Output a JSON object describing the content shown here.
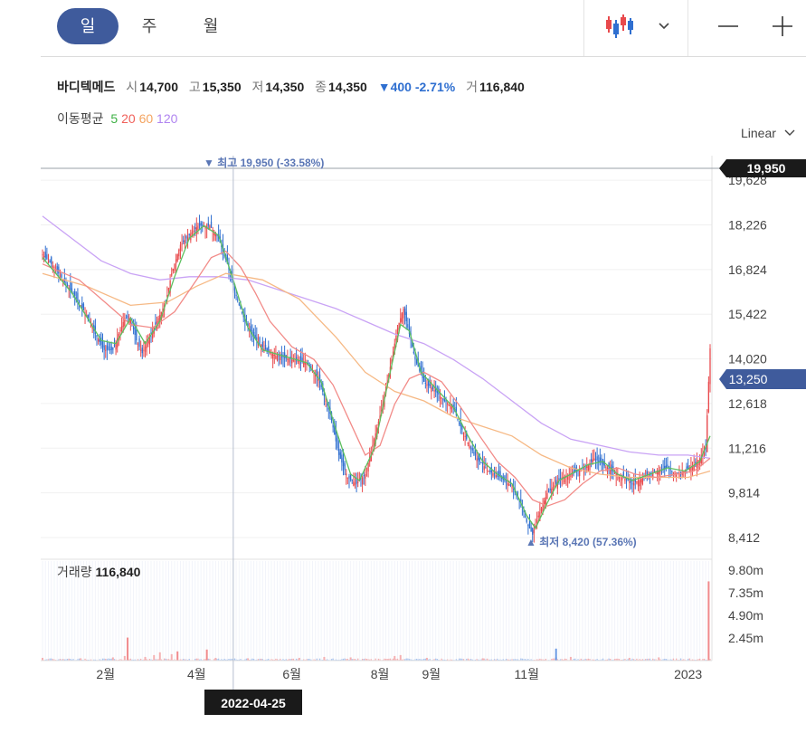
{
  "tabs": [
    {
      "label": "일",
      "active": true
    },
    {
      "label": "주",
      "active": false
    },
    {
      "label": "월",
      "active": false
    }
  ],
  "toolbar": {
    "chart_type_icon": "candlestick-icon",
    "dropdown_icon": "chevron-down-icon",
    "zoom_out_icon": "minus-icon",
    "zoom_in_icon": "plus-icon"
  },
  "stock": {
    "name": "바디텍메드",
    "open_label": "시",
    "open": "14,700",
    "high_label": "고",
    "high": "15,350",
    "low_label": "저",
    "low": "14,350",
    "close_label": "종",
    "close": "14,350",
    "change": "▼400 -2.71%",
    "volume_label": "거",
    "volume": "116,840"
  },
  "moving_average": {
    "label": "이동평균",
    "periods": [
      {
        "value": "5",
        "color": "#3cb043"
      },
      {
        "value": "20",
        "color": "#f0605a"
      },
      {
        "value": "60",
        "color": "#f4a460"
      },
      {
        "value": "120",
        "color": "#b084f0"
      }
    ]
  },
  "scale_mode": "Linear",
  "colors": {
    "up": "#e8494c",
    "down": "#2f6fd0",
    "active_tab": "#3f5b9c",
    "crosshair_label": "#1a1a1a",
    "last_price_label": "#3f5b9c"
  },
  "chart_data": {
    "type": "candlestick",
    "price_axis": {
      "ticks": [
        "19,628",
        "18,226",
        "16,824",
        "15,422",
        "14,020",
        "12,618",
        "11,216",
        "9,814",
        "8,412"
      ],
      "ylim": [
        7900,
        20400
      ]
    },
    "x_ticks": [
      "2월",
      "4월",
      "6월",
      "8월",
      "9월",
      "11월",
      "2023"
    ],
    "crosshair": {
      "date": "2022-04-25",
      "price": "19,950"
    },
    "last_price": "13,250",
    "max_marker": "▼ 최고 19,950 (-33.58%)",
    "min_marker": "▲ 최저 8,420 (57.36%)",
    "close_path": [
      [
        0,
        17300
      ],
      [
        8,
        16900
      ],
      [
        14,
        16500
      ],
      [
        22,
        16000
      ],
      [
        30,
        15400
      ],
      [
        36,
        14800
      ],
      [
        42,
        14300
      ],
      [
        48,
        14300
      ],
      [
        52,
        14800
      ],
      [
        56,
        15300
      ],
      [
        60,
        15300
      ],
      [
        64,
        14600
      ],
      [
        68,
        14200
      ],
      [
        72,
        14600
      ],
      [
        78,
        15200
      ],
      [
        84,
        15800
      ],
      [
        88,
        16700
      ],
      [
        94,
        17600
      ],
      [
        100,
        17900
      ],
      [
        106,
        18200
      ],
      [
        114,
        18200
      ],
      [
        120,
        17800
      ],
      [
        126,
        17000
      ],
      [
        132,
        16000
      ],
      [
        138,
        15200
      ],
      [
        144,
        14700
      ],
      [
        152,
        14300
      ],
      [
        160,
        14100
      ],
      [
        170,
        14000
      ],
      [
        180,
        13900
      ],
      [
        188,
        13400
      ],
      [
        196,
        12300
      ],
      [
        202,
        11000
      ],
      [
        208,
        10300
      ],
      [
        214,
        10100
      ],
      [
        220,
        10400
      ],
      [
        226,
        11500
      ],
      [
        232,
        12600
      ],
      [
        238,
        14000
      ],
      [
        242,
        15000
      ],
      [
        246,
        15600
      ],
      [
        250,
        14800
      ],
      [
        254,
        14000
      ],
      [
        260,
        13300
      ],
      [
        268,
        13000
      ],
      [
        274,
        12700
      ],
      [
        280,
        12500
      ],
      [
        284,
        12000
      ],
      [
        290,
        11400
      ],
      [
        296,
        10900
      ],
      [
        304,
        10500
      ],
      [
        312,
        10300
      ],
      [
        320,
        10000
      ],
      [
        326,
        9500
      ],
      [
        330,
        8900
      ],
      [
        334,
        8500
      ],
      [
        338,
        9100
      ],
      [
        344,
        9800
      ],
      [
        350,
        10100
      ],
      [
        354,
        10300
      ],
      [
        360,
        10400
      ],
      [
        370,
        10600
      ],
      [
        376,
        10900
      ],
      [
        382,
        10700
      ],
      [
        388,
        10500
      ],
      [
        396,
        10300
      ],
      [
        402,
        10100
      ],
      [
        410,
        10300
      ],
      [
        418,
        10500
      ],
      [
        426,
        10600
      ],
      [
        432,
        10400
      ],
      [
        438,
        10500
      ],
      [
        444,
        10700
      ],
      [
        448,
        10900
      ],
      [
        452,
        11200
      ],
      [
        455,
        14350
      ]
    ],
    "ma5": [
      [
        0,
        17200
      ],
      [
        20,
        16100
      ],
      [
        40,
        14600
      ],
      [
        50,
        14500
      ],
      [
        60,
        15300
      ],
      [
        70,
        14500
      ],
      [
        80,
        15200
      ],
      [
        90,
        16600
      ],
      [
        100,
        17800
      ],
      [
        110,
        18200
      ],
      [
        120,
        17900
      ],
      [
        130,
        16500
      ],
      [
        140,
        15000
      ],
      [
        150,
        14300
      ],
      [
        165,
        14100
      ],
      [
        180,
        13900
      ],
      [
        190,
        13300
      ],
      [
        200,
        11800
      ],
      [
        210,
        10400
      ],
      [
        216,
        10200
      ],
      [
        226,
        11200
      ],
      [
        236,
        13400
      ],
      [
        244,
        15100
      ],
      [
        250,
        14900
      ],
      [
        258,
        13600
      ],
      [
        270,
        13000
      ],
      [
        280,
        12500
      ],
      [
        290,
        11600
      ],
      [
        300,
        10800
      ],
      [
        310,
        10400
      ],
      [
        320,
        10100
      ],
      [
        330,
        9100
      ],
      [
        336,
        8700
      ],
      [
        344,
        9500
      ],
      [
        352,
        10200
      ],
      [
        360,
        10400
      ],
      [
        372,
        10700
      ],
      [
        382,
        10800
      ],
      [
        392,
        10400
      ],
      [
        402,
        10200
      ],
      [
        414,
        10400
      ],
      [
        426,
        10600
      ],
      [
        438,
        10500
      ],
      [
        448,
        10800
      ],
      [
        455,
        11600
      ]
    ],
    "ma20": [
      [
        0,
        17000
      ],
      [
        25,
        16500
      ],
      [
        45,
        15700
      ],
      [
        60,
        15100
      ],
      [
        75,
        15000
      ],
      [
        90,
        15500
      ],
      [
        105,
        16500
      ],
      [
        115,
        17200
      ],
      [
        125,
        17400
      ],
      [
        135,
        16900
      ],
      [
        145,
        16100
      ],
      [
        155,
        15200
      ],
      [
        170,
        14400
      ],
      [
        185,
        14000
      ],
      [
        198,
        13200
      ],
      [
        210,
        12000
      ],
      [
        220,
        11000
      ],
      [
        230,
        11300
      ],
      [
        240,
        12600
      ],
      [
        250,
        13400
      ],
      [
        260,
        13600
      ],
      [
        272,
        13300
      ],
      [
        285,
        12500
      ],
      [
        298,
        11600
      ],
      [
        310,
        10800
      ],
      [
        322,
        10300
      ],
      [
        334,
        9600
      ],
      [
        344,
        9400
      ],
      [
        356,
        9600
      ],
      [
        368,
        10100
      ],
      [
        380,
        10500
      ],
      [
        392,
        10600
      ],
      [
        404,
        10400
      ],
      [
        418,
        10300
      ],
      [
        432,
        10400
      ],
      [
        444,
        10500
      ],
      [
        455,
        10900
      ]
    ],
    "ma60": [
      [
        0,
        16700
      ],
      [
        30,
        16300
      ],
      [
        60,
        15700
      ],
      [
        85,
        15800
      ],
      [
        105,
        16300
      ],
      [
        125,
        16700
      ],
      [
        150,
        16500
      ],
      [
        175,
        15900
      ],
      [
        200,
        14700
      ],
      [
        220,
        13600
      ],
      [
        240,
        13000
      ],
      [
        260,
        12700
      ],
      [
        280,
        12200
      ],
      [
        300,
        11900
      ],
      [
        320,
        11600
      ],
      [
        340,
        11000
      ],
      [
        360,
        10600
      ],
      [
        380,
        10400
      ],
      [
        400,
        10300
      ],
      [
        420,
        10300
      ],
      [
        440,
        10300
      ],
      [
        455,
        10500
      ]
    ],
    "ma120": [
      [
        0,
        18500
      ],
      [
        20,
        17800
      ],
      [
        40,
        17100
      ],
      [
        60,
        16700
      ],
      [
        80,
        16500
      ],
      [
        100,
        16600
      ],
      [
        120,
        16600
      ],
      [
        140,
        16500
      ],
      [
        160,
        16200
      ],
      [
        180,
        15900
      ],
      [
        200,
        15600
      ],
      [
        220,
        15200
      ],
      [
        240,
        14800
      ],
      [
        260,
        14500
      ],
      [
        280,
        14000
      ],
      [
        300,
        13400
      ],
      [
        320,
        12700
      ],
      [
        340,
        12000
      ],
      [
        360,
        11500
      ],
      [
        380,
        11300
      ],
      [
        400,
        11100
      ],
      [
        420,
        11000
      ],
      [
        440,
        11000
      ],
      [
        455,
        10900
      ]
    ],
    "volume": {
      "label": "거래량",
      "value": "116,840",
      "ticks": [
        "9.80m",
        "7.35m",
        "4.90m",
        "2.45m"
      ],
      "max": 11000000,
      "spikes": [
        [
          0,
          300000
        ],
        [
          26,
          250000
        ],
        [
          48,
          350000
        ],
        [
          56,
          500000
        ],
        [
          58,
          2500000
        ],
        [
          70,
          400000
        ],
        [
          76,
          600000
        ],
        [
          80,
          900000
        ],
        [
          88,
          700000
        ],
        [
          92,
          1000000
        ],
        [
          112,
          1200000
        ],
        [
          118,
          300000
        ],
        [
          140,
          250000
        ],
        [
          175,
          300000
        ],
        [
          192,
          400000
        ],
        [
          210,
          350000
        ],
        [
          240,
          500000
        ],
        [
          244,
          600000
        ],
        [
          262,
          300000
        ],
        [
          300,
          250000
        ],
        [
          350,
          350000
        ],
        [
          350,
          1300000
        ],
        [
          360,
          400000
        ],
        [
          400,
          300000
        ],
        [
          420,
          350000
        ],
        [
          454,
          8600000
        ]
      ]
    }
  }
}
